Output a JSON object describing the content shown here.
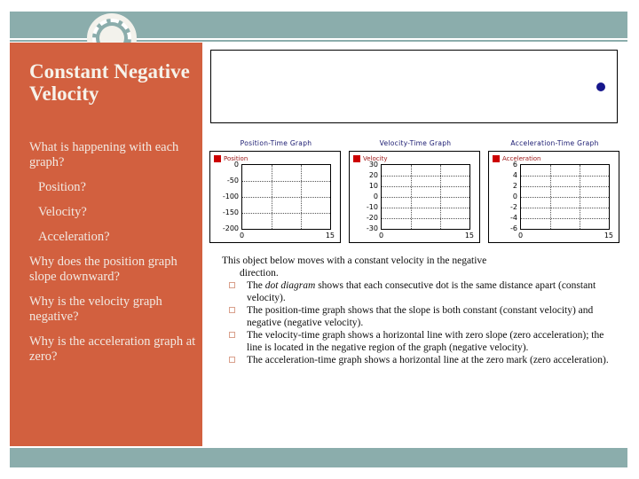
{
  "slide": {
    "title": "Constant Negative Velocity",
    "sidebar_questions": [
      "What is happening with each graph?",
      "Position?",
      "Velocity?",
      "Acceleration?",
      "Why does the position graph slope downward?",
      "Why is the velocity graph negative?",
      "Why is the acceleration graph at zero?"
    ],
    "colors": {
      "sidebar": "#d2603f",
      "band": "#8badac",
      "title_text": "#f6f2ea",
      "dot": "#16168c",
      "legend_swatch": "#cc0000",
      "legend_text": "#9b1414",
      "graph_title": "#191970",
      "bullet_square": "#d9a08c"
    }
  },
  "dot_diagram": {
    "name": "dot-diagram",
    "dot_count": 1
  },
  "graphs": [
    {
      "title": "Position-Time Graph",
      "legend": "Position",
      "ylabels": [
        "0",
        "-50",
        "-100",
        "-150",
        "-200"
      ],
      "xlabels": [
        "0",
        "15"
      ]
    },
    {
      "title": "Velocity-Time Graph",
      "legend": "Velocity",
      "ylabels": [
        "30",
        "20",
        "10",
        "0",
        "-10",
        "-20",
        "-30"
      ],
      "xlabels": [
        "0",
        "15"
      ]
    },
    {
      "title": "Acceleration-Time Graph",
      "legend": "Acceleration",
      "ylabels": [
        "6",
        "4",
        "2",
        "0",
        "-2",
        "-4",
        "-6"
      ],
      "xlabels": [
        "0",
        "15"
      ]
    }
  ],
  "body": {
    "lead_line1": "This object below moves with a constant velocity in the negative",
    "lead_line2": "direction.",
    "bullets": [
      {
        "pre": "The ",
        "em": "dot diagram",
        "post": " shows that each consecutive dot is the same distance apart (constant velocity)."
      },
      {
        "pre": "",
        "em": "",
        "post": "The position-time graph shows that the slope is both constant (constant velocity) and negative (negative velocity)."
      },
      {
        "pre": "",
        "em": "",
        "post": "The velocity-time graph shows a horizontal line with zero slope (zero acceleration); the line is located in the negative region of the graph (negative velocity)."
      },
      {
        "pre": "",
        "em": "",
        "post": "The acceleration-time graph shows a horizontal line at the zero mark (zero acceleration)."
      }
    ]
  },
  "chart_data": [
    {
      "type": "line",
      "title": "Position-Time Graph",
      "xlabel": "",
      "ylabel": "Position",
      "legend": [
        "Position"
      ],
      "xlim": [
        0,
        15
      ],
      "ylim": [
        -200,
        0
      ],
      "yticks": [
        0,
        -50,
        -100,
        -150,
        -200
      ],
      "xticks": [
        0,
        15
      ],
      "grid": true,
      "series": [
        {
          "name": "Position",
          "x": [],
          "values": []
        }
      ]
    },
    {
      "type": "line",
      "title": "Velocity-Time Graph",
      "xlabel": "",
      "ylabel": "Velocity",
      "legend": [
        "Velocity"
      ],
      "xlim": [
        0,
        15
      ],
      "ylim": [
        -30,
        30
      ],
      "yticks": [
        30,
        20,
        10,
        0,
        -10,
        -20,
        -30
      ],
      "xticks": [
        0,
        15
      ],
      "grid": true,
      "series": [
        {
          "name": "Velocity",
          "x": [],
          "values": []
        }
      ]
    },
    {
      "type": "line",
      "title": "Acceleration-Time Graph",
      "xlabel": "",
      "ylabel": "Acceleration",
      "legend": [
        "Acceleration"
      ],
      "xlim": [
        0,
        15
      ],
      "ylim": [
        -6,
        6
      ],
      "yticks": [
        6,
        4,
        2,
        0,
        -2,
        -4,
        -6
      ],
      "xticks": [
        0,
        15
      ],
      "grid": true,
      "series": [
        {
          "name": "Acceleration",
          "x": [],
          "values": []
        }
      ]
    }
  ]
}
